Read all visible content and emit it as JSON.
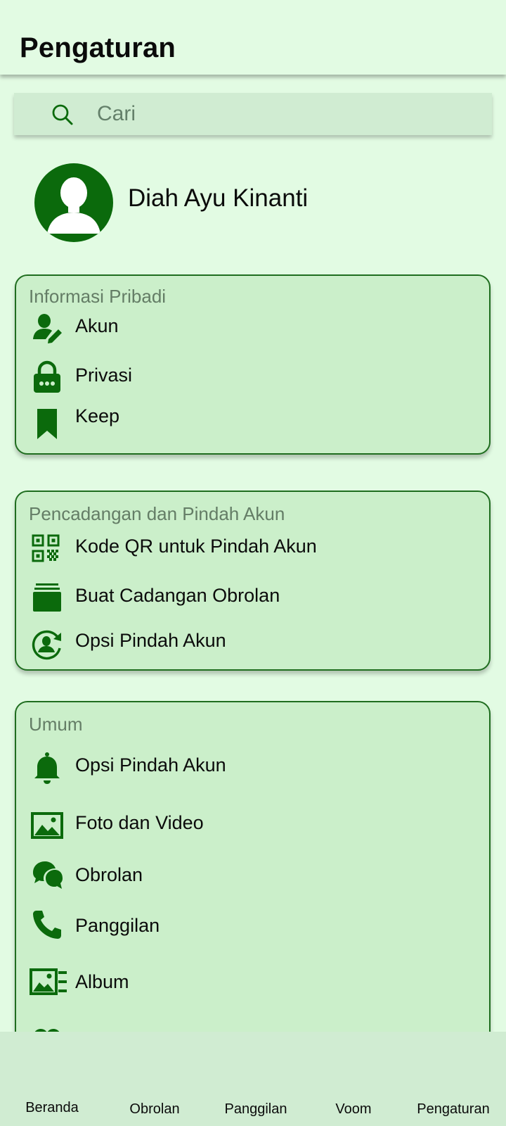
{
  "header": {
    "title": "Pengaturan"
  },
  "search": {
    "placeholder": "Cari",
    "icon": "search-icon"
  },
  "profile": {
    "name": "Diah Ayu Kinanti",
    "avatar_icon": "person-icon"
  },
  "sections": [
    {
      "title": "Informasi Pribadi",
      "items": [
        {
          "label": "Akun",
          "icon": "user-edit-icon"
        },
        {
          "label": "Privasi",
          "icon": "lock-icon"
        },
        {
          "label": "Keep",
          "icon": "bookmark-icon"
        }
      ]
    },
    {
      "title": "Pencadangan dan Pindah Akun",
      "items": [
        {
          "label": "Kode QR untuk Pindah Akun",
          "icon": "qr-code-icon"
        },
        {
          "label": "Buat Cadangan Obrolan",
          "icon": "backup-stack-icon"
        },
        {
          "label": "Opsi Pindah Akun",
          "icon": "account-transfer-icon"
        }
      ]
    },
    {
      "title": "Umum",
      "items": [
        {
          "label": "Opsi Pindah Akun",
          "icon": "bell-icon"
        },
        {
          "label": "Foto dan Video",
          "icon": "image-icon"
        },
        {
          "label": "Obrolan",
          "icon": "chat-bubbles-icon"
        },
        {
          "label": "Panggilan",
          "icon": "phone-icon"
        },
        {
          "label": "Album",
          "icon": "album-icon"
        }
      ]
    }
  ],
  "bottom_nav": [
    {
      "label": "Beranda"
    },
    {
      "label": "Obrolan"
    },
    {
      "label": "Panggilan"
    },
    {
      "label": "Voom"
    },
    {
      "label": "Pengaturan"
    }
  ],
  "colors": {
    "background": "#e2fbe3",
    "card": "#cbefca",
    "accent": "#0b6a0c",
    "section_title": "#647d66",
    "bottom_nav": "#d0ecd2"
  }
}
